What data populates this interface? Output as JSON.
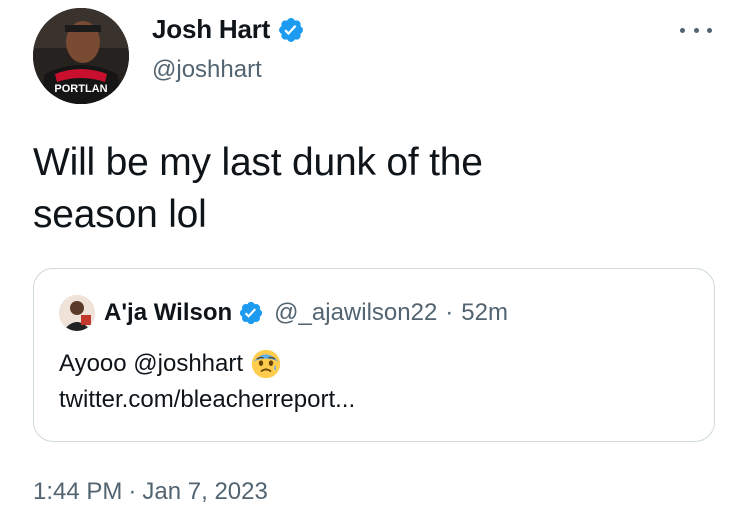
{
  "author": {
    "display_name": "Josh Hart",
    "handle": "@joshhart",
    "verified": true,
    "avatar_icon": "josh-hart-avatar"
  },
  "tweet": {
    "text_line1": "Will be my last dunk of the",
    "text_line2": "season lol",
    "time": "1:44 PM",
    "separator": "·",
    "date": "Jan 7, 2023"
  },
  "quote": {
    "display_name": "A'ja Wilson",
    "handle": "@_ajawilson22",
    "separator": "·",
    "time": "52m",
    "verified": true,
    "text_line1": "Ayooo @joshhart",
    "emoji": "anxious-face-emoji",
    "text_line2": "twitter.com/bleacherreport..."
  },
  "colors": {
    "verified_blue": "#1d9bf0",
    "text_primary": "#0f1419",
    "text_secondary": "#536471",
    "border": "#cfd9de"
  }
}
